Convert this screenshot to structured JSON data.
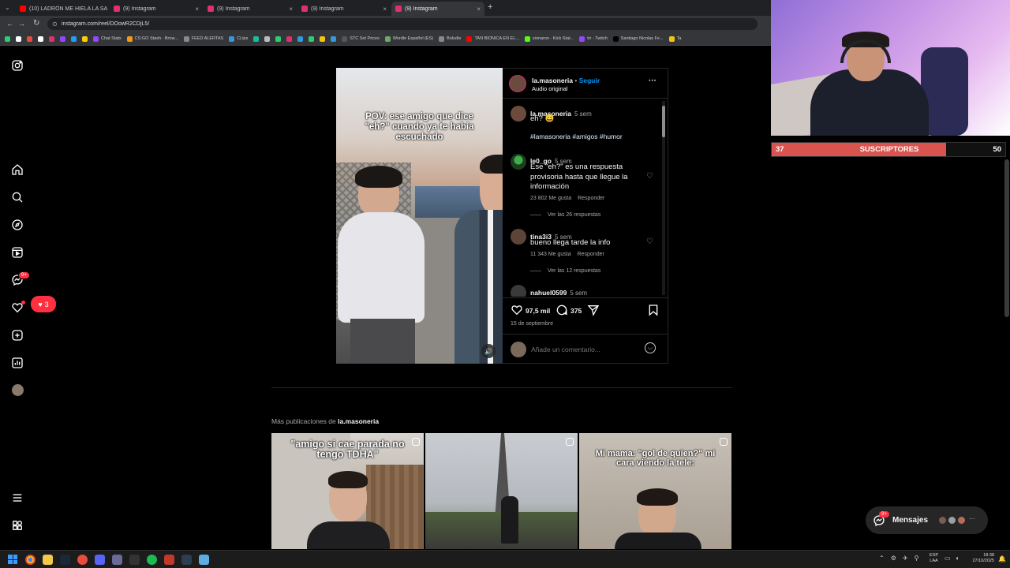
{
  "browser": {
    "tabs": [
      {
        "label": "(10) LADRÓN ME HIELA LA SA",
        "favicon_color": "#ff0000"
      },
      {
        "label": "(9) Instagram",
        "favicon_color": "#e1306c"
      },
      {
        "label": "(9) Instagram",
        "favicon_color": "#e1306c"
      },
      {
        "label": "(9) Instagram",
        "favicon_color": "#e1306c"
      },
      {
        "label": "(9) Instagram",
        "favicon_color": "#e1306c"
      }
    ],
    "new_tab": "+",
    "url": "instagram.com/reel/DOowR2CDjL5/",
    "bookmarks": [
      {
        "label": "",
        "color": "#2ecc71"
      },
      {
        "label": "",
        "color": "#ffffff"
      },
      {
        "label": "",
        "color": "#e74c3c"
      },
      {
        "label": "",
        "color": "#ffffff"
      },
      {
        "label": "",
        "color": "#e1306c"
      },
      {
        "label": "",
        "color": "#9146ff"
      },
      {
        "label": "",
        "color": "#1da1f2"
      },
      {
        "label": "",
        "color": "#ffcc00"
      },
      {
        "label": "Chat Stats",
        "color": "#9146ff"
      },
      {
        "label": "CS:GO Stash - Brow...",
        "color": "#f39c12"
      },
      {
        "label": "FEED ALERTAS",
        "color": "#888888"
      },
      {
        "label": "CLips",
        "color": "#3498db"
      },
      {
        "label": "",
        "color": "#1abc9c"
      },
      {
        "label": "",
        "color": "#bbbbbb"
      },
      {
        "label": "",
        "color": "#2ecc71"
      },
      {
        "label": "",
        "color": "#e1306c"
      },
      {
        "label": "",
        "color": "#3498db"
      },
      {
        "label": "",
        "color": "#2ecc71"
      },
      {
        "label": "",
        "color": "#f1c40f"
      },
      {
        "label": "",
        "color": "#3498db"
      },
      {
        "label": "STC Set Prices",
        "color": "#555555"
      },
      {
        "label": "Wordle Español (ES)",
        "color": "#6aaa64"
      },
      {
        "label": "Boludle",
        "color": "#888888"
      },
      {
        "label": "TAN BIONICA EN EL...",
        "color": "#ff0000"
      },
      {
        "label": "sionaron - Kick Stat...",
        "color": "#53fc18"
      },
      {
        "label": "trr - Twitch",
        "color": "#9146ff"
      },
      {
        "label": "Santiago Nicolas Fe...",
        "color": "#000000"
      },
      {
        "label": "Ta",
        "color": "#f1c40f"
      }
    ]
  },
  "sidebar": {
    "messages_badge": "9+",
    "notifications_count": "3"
  },
  "post": {
    "overlay_caption": "POV: ese amigo que dice \"eh?\" cuando ya te había escuchado",
    "username": "la.masoneria",
    "separator": "•",
    "follow_label": "Seguir",
    "audio": "Audio original",
    "more": "···",
    "caption_user": "la.masoneria",
    "caption_time": "5 sem",
    "caption_text": "eh? 😄",
    "hashtags": "#lamasoneria #amigos #humor",
    "comments": [
      {
        "user": "le0_go",
        "time": "5 sem",
        "text": "Ese \"eh?\" es una respuesta provisoria hasta que llegue la información",
        "likes": "23 802 Me gusta",
        "reply": "Responder",
        "replies": "Ver las 26 respuestas"
      },
      {
        "user": "tina3i3",
        "time": "5 sem",
        "text": "bueno llega tarde la info",
        "likes": "11 343 Me gusta",
        "reply": "Responder",
        "replies": "Ver las 12 respuestas"
      },
      {
        "user": "nahuel0599",
        "time": "5 sem",
        "text": ""
      }
    ],
    "likes_count": "97,5 mil",
    "comments_count": "375",
    "date": "15 de septiembre",
    "comment_placeholder": "Añade un comentario..."
  },
  "more_posts": {
    "prefix": "Más publicaciones de ",
    "username": "la.masoneria",
    "thumbs": [
      {
        "caption": "\"amigo si cae parada no tengo TDHA\""
      },
      {
        "caption": ""
      },
      {
        "caption": "Mi mama: \"gol de quien?\" mi cara viendo la tele:"
      }
    ]
  },
  "messages": {
    "label": "Mensajes",
    "badge": "9+",
    "more": "···"
  },
  "stream": {
    "subs_current": "37",
    "subs_label": "SUSCRIPTORES",
    "subs_goal": "50",
    "progress": 0.74
  },
  "taskbar": {
    "lang_top": "ESP",
    "lang_bottom": "LAA",
    "time": "18:38",
    "date": "27/10/2025"
  },
  "colors": {
    "instagram_bg": "#000000",
    "follow_blue": "#0095f6",
    "hashtag": "#e0f1ff",
    "badge_red": "#ff3040",
    "subs_bar": "#d9534f"
  }
}
